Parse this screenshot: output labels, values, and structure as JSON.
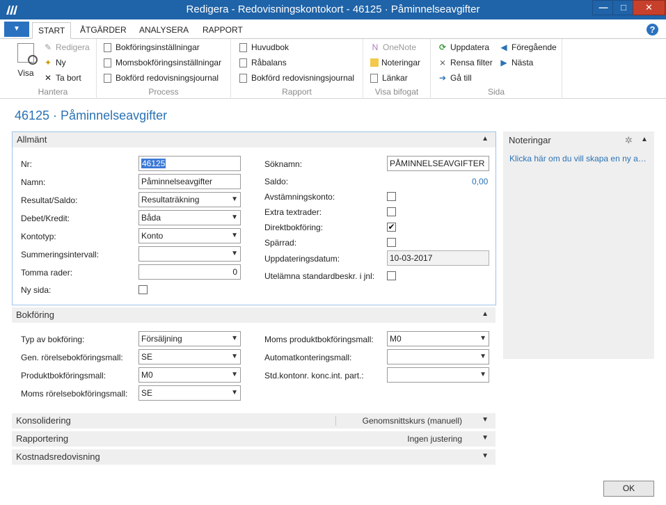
{
  "window": {
    "title": "Redigera - Redovisningskontokort - 46125 · Påminnelseavgifter",
    "min": "—",
    "max": "□",
    "close": "✕"
  },
  "ribbon_tabs": [
    "START",
    "ÅTGÄRDER",
    "ANALYSERA",
    "RAPPORT"
  ],
  "help": "?",
  "ribbon": {
    "hantera": {
      "name": "Hantera",
      "view": "Visa",
      "edit": "Redigera",
      "new": "Ny",
      "delete": "Ta bort"
    },
    "process": {
      "name": "Process",
      "items": [
        "Bokföringsinställningar",
        "Momsbokföringsinställningar",
        "Bokförd redovisningsjournal"
      ]
    },
    "rapport": {
      "name": "Rapport",
      "items": [
        "Huvudbok",
        "Råbalans",
        "Bokförd redovisningsjournal"
      ]
    },
    "bifogat": {
      "name": "Visa bifogat",
      "items": [
        "OneNote",
        "Noteringar",
        "Länkar"
      ]
    },
    "sida": {
      "name": "Sida",
      "items": [
        "Uppdatera",
        "Rensa filter",
        "Gå till",
        "Föregående",
        "Nästa"
      ]
    }
  },
  "page_title": "46125 · Påminnelseavgifter",
  "general": {
    "header": "Allmänt",
    "labels": {
      "nr": "Nr:",
      "namn": "Namn:",
      "resultat": "Resultat/Saldo:",
      "debet": "Debet/Kredit:",
      "kontotyp": "Kontotyp:",
      "summering": "Summeringsintervall:",
      "tomma": "Tomma rader:",
      "nysida": "Ny sida:",
      "soknamn": "Söknamn:",
      "saldo": "Saldo:",
      "avstamning": "Avstämningskonto:",
      "extra": "Extra textrader:",
      "direkt": "Direktbokföring:",
      "sparrad": "Spärrad:",
      "uppdatering": "Uppdateringsdatum:",
      "utelamna": "Utelämna standardbeskr. i jnl:"
    },
    "values": {
      "nr": "46125",
      "namn": "Påminnelseavgifter",
      "resultat": "Resultaträkning",
      "debet": "Båda",
      "kontotyp": "Konto",
      "summering": "",
      "tomma": "0",
      "soknamn": "PÅMINNELSEAVGIFTER",
      "saldo": "0,00",
      "uppdatering": "10-03-2017"
    },
    "checks": {
      "nysida": false,
      "avstamning": false,
      "extra": false,
      "direkt": true,
      "sparrad": false,
      "utelamna": false
    }
  },
  "posting": {
    "header": "Bokföring",
    "labels": {
      "typ": "Typ av bokföring:",
      "gen": "Gen. rörelsebokföringsmall:",
      "prod": "Produktbokföringsmall:",
      "moms_rorelse": "Moms rörelsebokföringsmall:",
      "moms_prod": "Moms produktbokföringsmall:",
      "auto": "Automatkonteringsmall:",
      "std": "Std.kontonr. konc.int. part.:"
    },
    "values": {
      "typ": "Försäljning",
      "gen": "SE",
      "prod": "M0",
      "moms_rorelse": "SE",
      "moms_prod": "M0",
      "auto": "",
      "std": ""
    }
  },
  "sections": {
    "konsolidering": {
      "label": "Konsolidering",
      "summary": "Genomsnittskurs (manuell)"
    },
    "rapportering": {
      "label": "Rapportering",
      "summary": "Ingen justering"
    },
    "kostnad": {
      "label": "Kostnadsredovisning",
      "summary": ""
    }
  },
  "notes": {
    "title": "Noteringar",
    "link": "Klicka här om du vill skapa en ny anteckning"
  },
  "ok": "OK",
  "icons": {
    "collapse": "▲",
    "expand": "▼",
    "dropdown": "⌄"
  }
}
